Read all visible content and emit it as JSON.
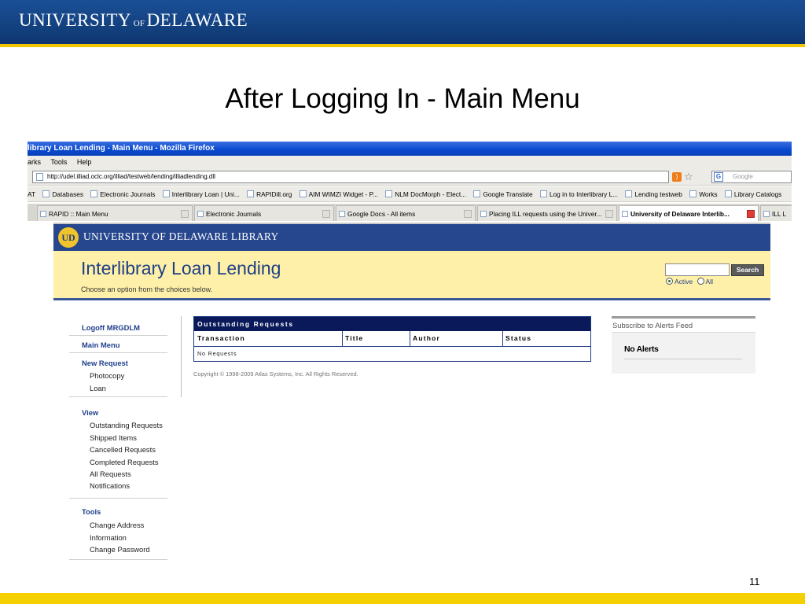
{
  "slide": {
    "brand": {
      "part1": "UNIVERSITY",
      "part2": "OF",
      "part3": "DELAWARE"
    },
    "title": "After Logging In - Main Menu",
    "page_number": "11"
  },
  "browser": {
    "window_title": "library Loan Lending - Main Menu - Mozilla Firefox",
    "menu": [
      "arks",
      "Tools",
      "Help"
    ],
    "url": "http://udel.illiad.oclc.org/illiad/testweb/lending/illiadlending.dll",
    "search_placeholder": "Google",
    "bookmarks": [
      "AT",
      "Databases",
      "Electronic Journals",
      "Interlibrary Loan | Uni...",
      "RAPIDill.org",
      "AIM WIMZI Widget - P...",
      "NLM DocMorph - Elect...",
      "Google Translate",
      "Log in to Interlibrary L...",
      "Lending testweb",
      "Works",
      "Library Catalogs"
    ],
    "tabs": [
      "RAPID :: Main Menu",
      "Electronic Journals",
      "Google Docs - All items",
      "Placing ILL requests using the Univer...",
      "University of Delaware Interlib...",
      "ILL L"
    ]
  },
  "library": {
    "bar_title": "UNIVERSITY OF DELAWARE LIBRARY",
    "heading": "Interlibrary Loan Lending",
    "subheading": "Choose an option from the choices below.",
    "search_button": "Search",
    "radio_active": "Active",
    "radio_all": "All"
  },
  "nav": {
    "logoff": "Logoff MRGDLM",
    "main_menu": "Main Menu",
    "new_request": {
      "heading": "New Request",
      "items": [
        "Photocopy",
        "Loan"
      ]
    },
    "view": {
      "heading": "View",
      "items": [
        "Outstanding Requests",
        "Shipped Items",
        "Cancelled Requests",
        "Completed Requests",
        "All Requests",
        "Notifications"
      ]
    },
    "tools": {
      "heading": "Tools",
      "items": [
        "Change Address",
        "Information",
        "Change Password"
      ]
    }
  },
  "requests": {
    "caption": "Outstanding Requests",
    "columns": [
      "Transaction",
      "Title",
      "Author",
      "Status"
    ],
    "empty": "No Requests"
  },
  "copyright": "Copyright © 1998-2009 Atlas Systems, Inc. All Rights Reserved.",
  "alerts": {
    "subscribe": "Subscribe to Alerts Feed",
    "empty": "No Alerts"
  },
  "colors": {
    "slide_header": "#123f7c",
    "gold": "#f2c500",
    "library_blue": "#26468d",
    "banner_yellow": "#fef0a9",
    "table_header": "#09195a"
  }
}
